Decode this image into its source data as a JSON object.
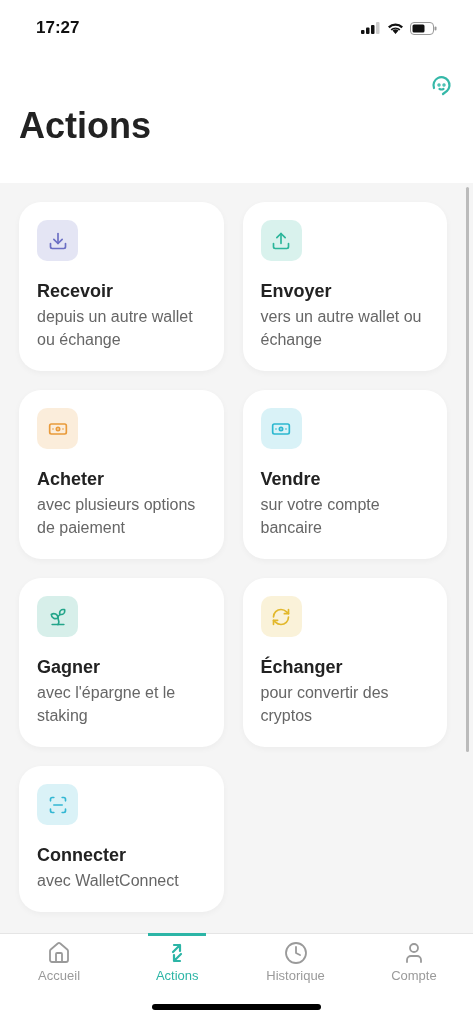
{
  "status_bar": {
    "time": "17:27"
  },
  "header": {
    "title": "Actions"
  },
  "actions": [
    {
      "kind": "receive",
      "title": "Recevoir",
      "subtitle": "depuis un autre wallet ou échange",
      "color": "#6b6fc4"
    },
    {
      "kind": "send",
      "title": "Envoyer",
      "subtitle": "vers un autre wallet ou échange",
      "color": "#2bb59a"
    },
    {
      "kind": "buy",
      "title": "Acheter",
      "subtitle": "avec plusieurs options de paiement",
      "color": "#e99a3a"
    },
    {
      "kind": "sell",
      "title": "Vendre",
      "subtitle": "sur votre compte bancaire",
      "color": "#2cb8d0"
    },
    {
      "kind": "earn",
      "title": "Gagner",
      "subtitle": "avec l'épargne et le staking",
      "color": "#23a58a"
    },
    {
      "kind": "swap",
      "title": "Échanger",
      "subtitle": "pour convertir des cryptos",
      "color": "#e2b82c"
    },
    {
      "kind": "connect",
      "title": "Connecter",
      "subtitle": "avec WalletConnect",
      "color": "#33b7d3"
    }
  ],
  "tab_bar": [
    {
      "kind": "home",
      "label": "Accueil",
      "selected": false
    },
    {
      "kind": "actions",
      "label": "Actions",
      "selected": true
    },
    {
      "kind": "history",
      "label": "Historique",
      "selected": false
    },
    {
      "kind": "account",
      "label": "Compte",
      "selected": false
    }
  ]
}
